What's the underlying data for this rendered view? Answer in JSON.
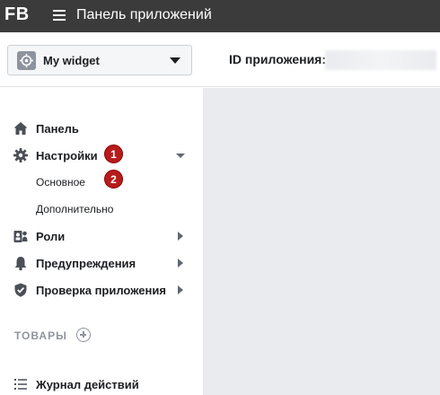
{
  "topbar": {
    "logo": "FB",
    "title": "Панель приложений"
  },
  "header": {
    "app_name": "My widget",
    "app_id_label": "ID приложения:",
    "app_id_value": ""
  },
  "sidebar": {
    "items": [
      {
        "label": "Панель",
        "icon": "home-icon"
      },
      {
        "label": "Настройки",
        "icon": "gear-icon",
        "badge": "1",
        "expanded": true
      },
      {
        "label": "Основное",
        "badge": "2"
      },
      {
        "label": "Дополнительно"
      },
      {
        "label": "Роли",
        "icon": "roles-icon"
      },
      {
        "label": "Предупреждения",
        "icon": "bell-icon"
      },
      {
        "label": "Проверка приложения",
        "icon": "shield-check-icon"
      }
    ],
    "products_section": "ТОВАРЫ",
    "activity_log": {
      "label": "Журнал действий",
      "icon": "list-icon"
    }
  },
  "colors": {
    "topbar": "#3b3b3b",
    "badge": "#b71c1c",
    "content_bg": "#e9ebee"
  }
}
